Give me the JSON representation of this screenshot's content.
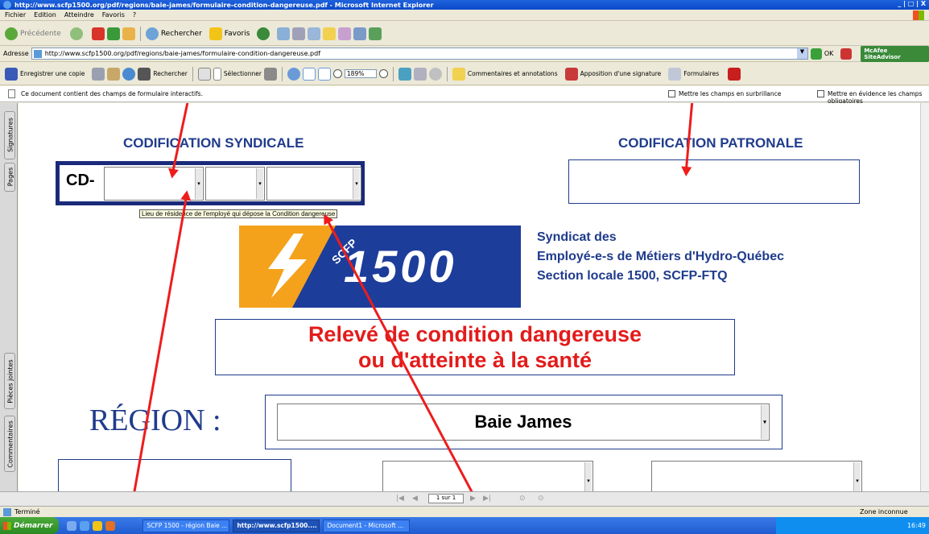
{
  "window": {
    "title": "http://www.scfp1500.org/pdf/regions/baie-james/formulaire-condition-dangereuse.pdf - Microsoft Internet Explorer",
    "controls": "_ | □ | X"
  },
  "menu": [
    "Fichier",
    "Edition",
    "Atteindre",
    "Favoris",
    "?"
  ],
  "nav": {
    "back": "Précédente",
    "search": "Rechercher",
    "favorites": "Favoris"
  },
  "address": {
    "label": "Adresse",
    "url": "http://www.scfp1500.org/pdf/regions/baie-james/formulaire-condition-dangereuse.pdf",
    "ok": "OK",
    "mcafee": "McAfee SiteAdvisor"
  },
  "pdf_toolbar": {
    "save": "Enregistrer une copie",
    "search": "Rechercher",
    "select": "Sélectionner",
    "zoom": "189%",
    "comments": "Commentaires et annotations",
    "sign": "Apposition d'une signature",
    "forms": "Formulaires"
  },
  "form_bar": {
    "message": "Ce document contient des champs de formulaire interactifs.",
    "highlight": "Mettre les champs en surbrillance",
    "required": "Mettre en évidence les champs obligatoires"
  },
  "side_tabs": [
    "Signatures",
    "Pages",
    "Pièces jointes",
    "Commentaires"
  ],
  "doc": {
    "union_heading": "CODIFICATION SYNDICALE",
    "cd_label": "CD-",
    "employer_heading": "CODIFICATION PATRONALE",
    "tooltip": "Lieu de résidence de l'employé qui dépose la Condition dangereuse",
    "logo_text": "SCFP",
    "logo_number": "1500",
    "union_name": [
      "Syndicat des",
      "Employé-e-s de Métiers d'Hydro-Québec",
      "Section locale 1500, SCFP-FTQ"
    ],
    "title_line1": "Relevé de condition dangereuse",
    "title_line2": "ou d'atteinte à la santé",
    "region_label": "RÉGION :",
    "region_value": "Baie James"
  },
  "page_nav": {
    "page": "1 sur 1"
  },
  "status": {
    "left": "Terminé",
    "zone": "Zone inconnue"
  },
  "taskbar": {
    "start": "Démarrer",
    "items": [
      "SCFP 1500 - région Baie ...",
      "http://www.scfp1500....",
      "Document1 - Microsoft ..."
    ],
    "clock": "16:49"
  },
  "colors": {
    "heading_blue": "#1f3b8c",
    "title_red": "#e31b1b",
    "logo_blue": "#1d3d9b",
    "logo_yellow": "#f4a21c",
    "xp_blue": "#0a5bd8"
  }
}
